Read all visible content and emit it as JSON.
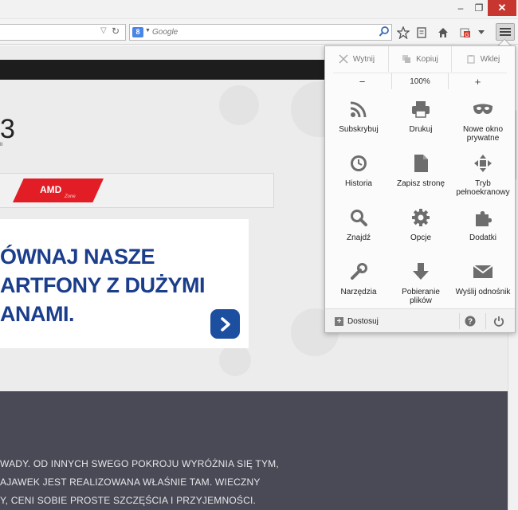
{
  "window": {
    "minimize_glyph": "‒",
    "maximize_glyph": "❐",
    "close_glyph": "✕"
  },
  "search": {
    "placeholder": "Google",
    "engine_letter": "8"
  },
  "menu": {
    "edit": {
      "cut": "Wytnij",
      "copy": "Kopiuj",
      "paste": "Wklej"
    },
    "zoom": {
      "out": "−",
      "level": "100%",
      "in": "+"
    },
    "items": [
      {
        "label": "Subskrybuj",
        "icon": "rss-icon"
      },
      {
        "label": "Drukuj",
        "icon": "print-icon"
      },
      {
        "label": "Nowe okno prywatne",
        "icon": "private-mask-icon"
      },
      {
        "label": "Historia",
        "icon": "history-clock-icon"
      },
      {
        "label": "Zapisz stronę",
        "icon": "save-page-icon"
      },
      {
        "label": "Tryb pełnoekranowy",
        "icon": "fullscreen-icon"
      },
      {
        "label": "Znajdź",
        "icon": "find-icon"
      },
      {
        "label": "Opcje",
        "icon": "options-gear-icon"
      },
      {
        "label": "Dodatki",
        "icon": "addons-puzzle-icon"
      },
      {
        "label": "Narzędzia",
        "icon": "tools-wrench-icon"
      },
      {
        "label": "Pobieranie plików",
        "icon": "downloads-icon"
      },
      {
        "label": "Wyślij odnośnik",
        "icon": "email-link-icon"
      }
    ],
    "footer": {
      "customize": "Dostosuj",
      "help_glyph": "?"
    }
  },
  "page": {
    "logo_fragment": "3",
    "logo_sub": "II",
    "amd": {
      "brand": "AMD",
      "zone": "Zone"
    },
    "ad_lines": [
      "ÓWNAJ NASZE",
      "ARTFONY Z DUŻYMI",
      "ANAMI."
    ],
    "article_lines": [
      "WADY. OD INNYCH SWEGO POKROJU WYRÓŻNIA SIĘ TYM,",
      "AJAWEK JEST REALIZOWANA WŁAŚNIE TAM. WIECZNY",
      "Y, CENI SOBIE PROSTE SZCZĘŚCIA I PRZYJEMNOŚCI."
    ]
  },
  "colors": {
    "accent_blue": "#1a3d8c",
    "amd_red": "#e21d26",
    "close_red": "#c7372f",
    "icon_gray": "#6d6d6d",
    "dark_section": "#4a4a56"
  }
}
